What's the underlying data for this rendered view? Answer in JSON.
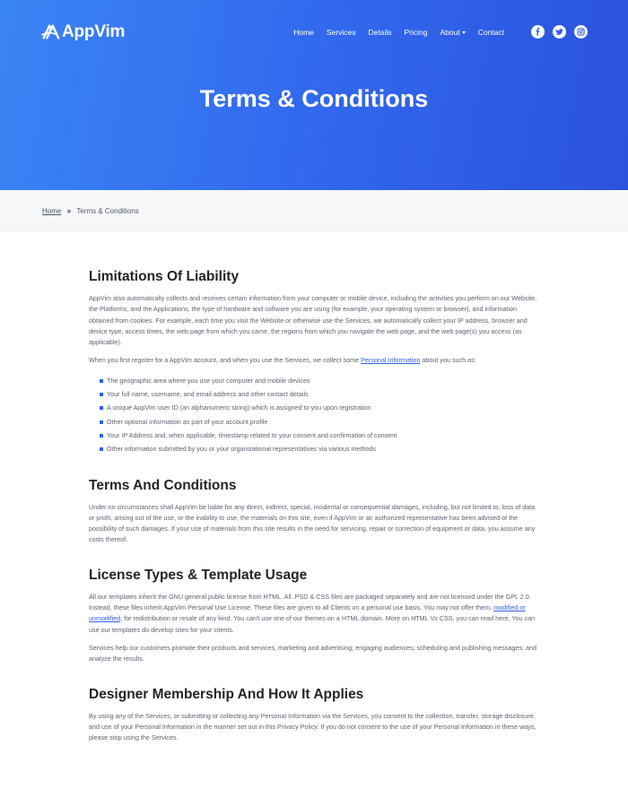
{
  "brand": {
    "name": "AppVim",
    "logo_icon": "appvim-logo-icon"
  },
  "nav": {
    "items": [
      {
        "label": "Home"
      },
      {
        "label": "Services"
      },
      {
        "label": "Details"
      },
      {
        "label": "Pricing"
      },
      {
        "label": "About",
        "dropdown": true
      },
      {
        "label": "Contact"
      }
    ],
    "social": [
      "facebook-icon",
      "twitter-icon",
      "instagram-icon"
    ]
  },
  "hero": {
    "title": "Terms & Conditions"
  },
  "breadcrumb": {
    "home": "Home",
    "separator": "»",
    "current": "Terms & Conditions"
  },
  "sections": [
    {
      "heading": "Limitations Of Liability",
      "p1": "AppVim also automatically collects and receives certain information from your computer or mobile device, including the activities you perform on our Website, the Platforms, and the Applications, the type of hardware and software you are using (for example, your operating system or browser), and information obtained from cookies. For example, each time you visit the Website or otherwise use the Services, we automatically collect your IP address, browser and device type, access times, the web page from which you came, the regions from which you navigate the web page, and the web page(s) you access (as applicable).",
      "p2_before": "When you first register for a AppVim account, and when you use the Services, we collect some ",
      "p2_link": "Personal Information",
      "p2_after": " about you such as:",
      "bullets": [
        "The geographic area where you use your computer and mobile devices",
        "Your full name, username, and email address and other contact details",
        "A unique AppVim user ID (an alphanumeric string) which is assigned to you upon registration",
        "Other optional information as part of your account profile",
        "Your IP Address and, when applicable, timestamp related to your consent and confirmation of consent",
        "Other information submitted by you or your organizational representatives via various methods"
      ]
    },
    {
      "heading": "Terms And Conditions",
      "p1": "Under no circumstances shall AppVim be liable for any direct, indirect, special, incidental or consequential damages, including, but not limited to, loss of data or profit, arising out of the use, or the inability to use, the materials on this site, even if AppVim or an authorized representative has been advised of the possibility of such damages. If your use of materials from this site results in the need for servicing, repair or correction of equipment or data, you assume any costs thereof."
    },
    {
      "heading": "License Types & Template Usage",
      "p1_before": "All our templates inherit the GNU general public license from HTML. All .PSD & CSS files are packaged separately and are not licensed under the GPL 2.0. Instead, these files inherit AppVim Personal Use License. These files are given to all Clients on a personal use basis. You may not offer them, ",
      "p1_link": "modified or unmodified",
      "p1_after": ", for redistribution or resale of any kind. You can't use one of our themes on a HTML domain. More on HTML Vs CSS, you can read here. You can use our templates do develop sites for your clients.",
      "p2": "Services help our customers promote their products and services, marketing and advertising; engaging audiences; scheduling and publishing messages; and analyze the results."
    },
    {
      "heading": "Designer Membership And How It Applies",
      "p1": "By using any of the Services, or submitting or collecting any Personal Information via the Services, you consent to the collection, transfer, storage disclosure, and use of your Personal Information in the manner set out in this Privacy Policy. If you do not consent to the use of your Personal Information in these ways, please stop using the Services."
    }
  ]
}
